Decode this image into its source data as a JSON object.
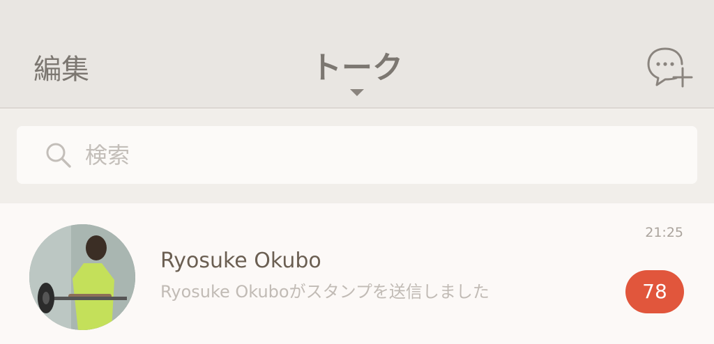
{
  "header": {
    "edit_label": "編集",
    "title": "トーク",
    "new_chat_icon": "new-chat-icon"
  },
  "search": {
    "placeholder": "検索",
    "value": "",
    "icon": "search-icon"
  },
  "chats": [
    {
      "name": "Ryosuke Okubo",
      "preview": "Ryosuke Okuboがスタンプを送信しました",
      "time": "21:25",
      "unread": "78"
    }
  ],
  "colors": {
    "header_bg": "#e9e6e2",
    "text_muted": "#7c7771",
    "badge": "#e1563c",
    "list_bg": "#fcf9f7"
  }
}
